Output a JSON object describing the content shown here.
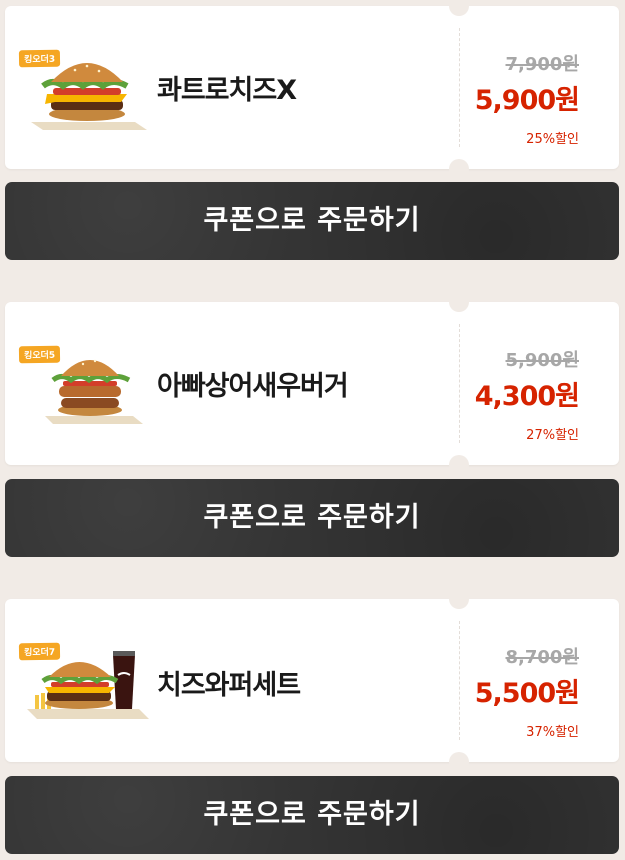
{
  "coupons": [
    {
      "badge": "킹오더3",
      "name": "콰트로치즈X",
      "original_price": "7,900원",
      "sale_price": "5,900원",
      "discount": "25%할인",
      "button_label": "쿠폰으로 주문하기"
    },
    {
      "badge": "킹오더5",
      "name": "아빠상어새우버거",
      "original_price": "5,900원",
      "sale_price": "4,300원",
      "discount": "27%할인",
      "button_label": "쿠폰으로 주문하기"
    },
    {
      "badge": "킹오더7",
      "name": "치즈와퍼세트",
      "original_price": "8,700원",
      "sale_price": "5,500원",
      "discount": "37%할인",
      "button_label": "쿠폰으로 주문하기"
    }
  ],
  "colors": {
    "background": "#f1ebe6",
    "accent_red": "#d62300",
    "badge_orange": "#f5a623",
    "button_dark": "#343434"
  },
  "icons": [
    "chili-pepper-icon",
    "burger-image",
    "drink-cup-image",
    "fries-image"
  ]
}
